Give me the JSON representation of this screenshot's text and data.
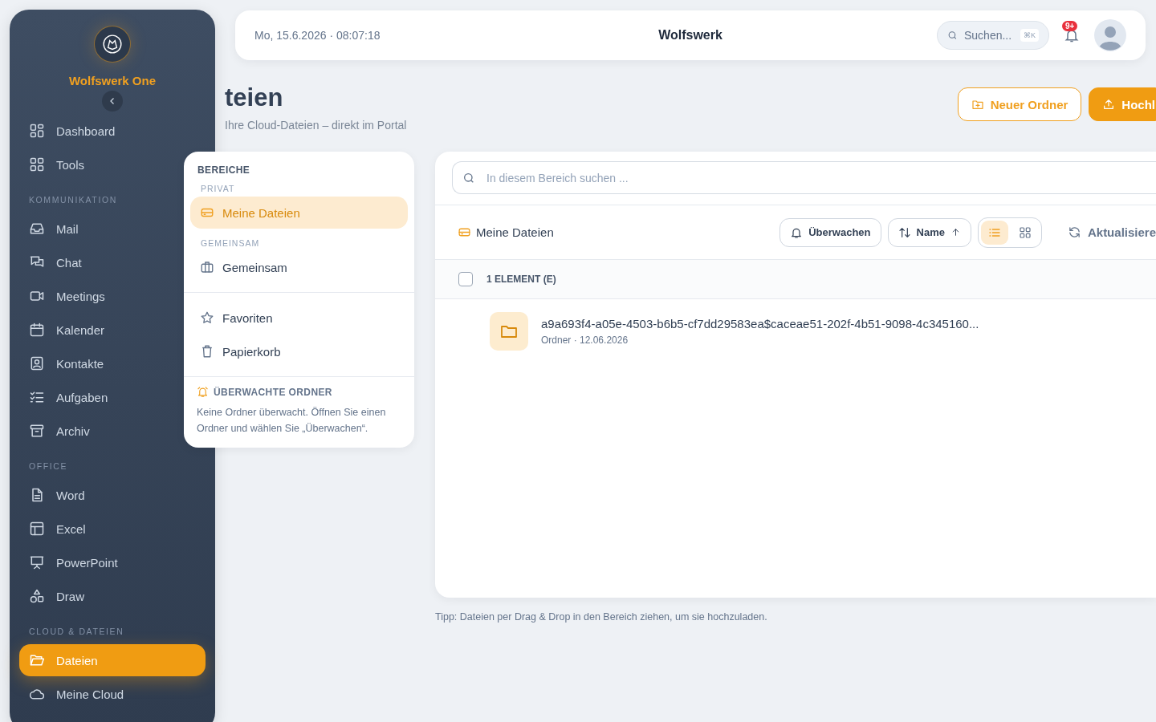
{
  "sidebar": {
    "brand": "Wolfswerk One",
    "sections": [
      {
        "items": [
          {
            "label": "Dashboard",
            "selected": false
          },
          {
            "label": "Tools",
            "selected": false
          }
        ]
      },
      {
        "title": "KOMMUNIKATION",
        "items": [
          {
            "label": "Mail",
            "selected": false
          },
          {
            "label": "Chat",
            "selected": false
          },
          {
            "label": "Meetings",
            "selected": false
          },
          {
            "label": "Kalender",
            "selected": false
          },
          {
            "label": "Kontakte",
            "selected": false
          },
          {
            "label": "Aufgaben",
            "selected": false
          },
          {
            "label": "Archiv",
            "selected": false
          }
        ]
      },
      {
        "title": "OFFICE",
        "items": [
          {
            "label": "Word",
            "selected": false
          },
          {
            "label": "Excel",
            "selected": false
          },
          {
            "label": "PowerPoint",
            "selected": false
          },
          {
            "label": "Draw",
            "selected": false
          }
        ]
      },
      {
        "title": "CLOUD & DATEIEN",
        "items": [
          {
            "label": "Dateien",
            "selected": true
          },
          {
            "label": "Meine Cloud",
            "selected": false
          }
        ]
      }
    ]
  },
  "topbar": {
    "datetime": "Mo, 15.6.2026 · 08:07:18",
    "title": "Wolfswerk",
    "search_placeholder": "Suchen...",
    "shortcut": "⌘K",
    "notification_badge": "9+"
  },
  "page": {
    "title": "teien",
    "subtitle": "Ihre Cloud-Dateien – direkt im Portal",
    "buttons": [
      {
        "label": "Neuer Ordner",
        "kind": "outline"
      },
      {
        "label": "Hochl",
        "kind": "primary"
      }
    ]
  },
  "areas": {
    "title": "BEREICHE",
    "groups": [
      {
        "label": "PRIVAT",
        "items": [
          {
            "label": "Meine Dateien",
            "selected": true
          }
        ]
      },
      {
        "label": "GEMEINSAM",
        "items": [
          {
            "label": "Gemeinsam",
            "selected": false
          }
        ]
      }
    ],
    "links": [
      {
        "label": "Favoriten",
        "selected": false
      },
      {
        "label": "Papierkorb",
        "selected": false
      }
    ],
    "watched": {
      "title": "ÜBERWACHTE ORDNER",
      "text": "Keine Ordner überwacht. Öffnen Sie einen Ordner und wählen Sie „Überwachen“."
    }
  },
  "files": {
    "search_placeholder": "In diesem Bereich suchen ...",
    "breadcrumb": "Meine Dateien",
    "watch": "Überwachen",
    "sort": "Name",
    "view_modes": [
      {
        "selected": true
      },
      {
        "selected": false
      }
    ],
    "refresh": "Aktualisiere",
    "select_all": {
      "checked": false
    },
    "count": "1 ELEMENT (E)",
    "items": [
      {
        "name": "a9a693f4-a05e-4503-b6b5-cf7dd29583ea$caceae51-202f-4b51-9098-4c345160...",
        "meta": "Ordner · 12.06.2026"
      }
    ]
  },
  "tip": "Tipp: Dateien per Drag & Drop in den Bereich ziehen, um sie hochzuladen."
}
